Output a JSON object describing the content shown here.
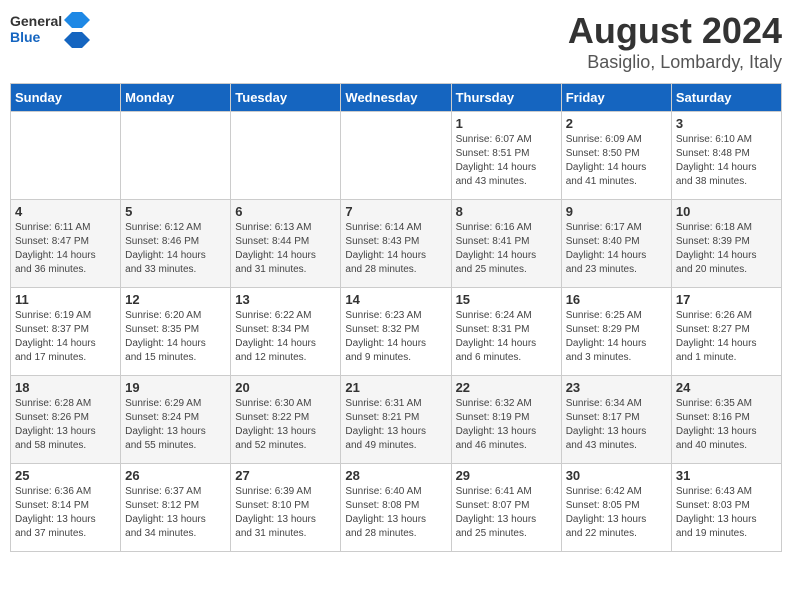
{
  "header": {
    "logo_general": "General",
    "logo_blue": "Blue",
    "title": "August 2024",
    "subtitle": "Basiglio, Lombardy, Italy"
  },
  "days_of_week": [
    "Sunday",
    "Monday",
    "Tuesday",
    "Wednesday",
    "Thursday",
    "Friday",
    "Saturday"
  ],
  "weeks": [
    [
      {
        "day": "",
        "info": ""
      },
      {
        "day": "",
        "info": ""
      },
      {
        "day": "",
        "info": ""
      },
      {
        "day": "",
        "info": ""
      },
      {
        "day": "1",
        "info": "Sunrise: 6:07 AM\nSunset: 8:51 PM\nDaylight: 14 hours\nand 43 minutes."
      },
      {
        "day": "2",
        "info": "Sunrise: 6:09 AM\nSunset: 8:50 PM\nDaylight: 14 hours\nand 41 minutes."
      },
      {
        "day": "3",
        "info": "Sunrise: 6:10 AM\nSunset: 8:48 PM\nDaylight: 14 hours\nand 38 minutes."
      }
    ],
    [
      {
        "day": "4",
        "info": "Sunrise: 6:11 AM\nSunset: 8:47 PM\nDaylight: 14 hours\nand 36 minutes."
      },
      {
        "day": "5",
        "info": "Sunrise: 6:12 AM\nSunset: 8:46 PM\nDaylight: 14 hours\nand 33 minutes."
      },
      {
        "day": "6",
        "info": "Sunrise: 6:13 AM\nSunset: 8:44 PM\nDaylight: 14 hours\nand 31 minutes."
      },
      {
        "day": "7",
        "info": "Sunrise: 6:14 AM\nSunset: 8:43 PM\nDaylight: 14 hours\nand 28 minutes."
      },
      {
        "day": "8",
        "info": "Sunrise: 6:16 AM\nSunset: 8:41 PM\nDaylight: 14 hours\nand 25 minutes."
      },
      {
        "day": "9",
        "info": "Sunrise: 6:17 AM\nSunset: 8:40 PM\nDaylight: 14 hours\nand 23 minutes."
      },
      {
        "day": "10",
        "info": "Sunrise: 6:18 AM\nSunset: 8:39 PM\nDaylight: 14 hours\nand 20 minutes."
      }
    ],
    [
      {
        "day": "11",
        "info": "Sunrise: 6:19 AM\nSunset: 8:37 PM\nDaylight: 14 hours\nand 17 minutes."
      },
      {
        "day": "12",
        "info": "Sunrise: 6:20 AM\nSunset: 8:35 PM\nDaylight: 14 hours\nand 15 minutes."
      },
      {
        "day": "13",
        "info": "Sunrise: 6:22 AM\nSunset: 8:34 PM\nDaylight: 14 hours\nand 12 minutes."
      },
      {
        "day": "14",
        "info": "Sunrise: 6:23 AM\nSunset: 8:32 PM\nDaylight: 14 hours\nand 9 minutes."
      },
      {
        "day": "15",
        "info": "Sunrise: 6:24 AM\nSunset: 8:31 PM\nDaylight: 14 hours\nand 6 minutes."
      },
      {
        "day": "16",
        "info": "Sunrise: 6:25 AM\nSunset: 8:29 PM\nDaylight: 14 hours\nand 3 minutes."
      },
      {
        "day": "17",
        "info": "Sunrise: 6:26 AM\nSunset: 8:27 PM\nDaylight: 14 hours\nand 1 minute."
      }
    ],
    [
      {
        "day": "18",
        "info": "Sunrise: 6:28 AM\nSunset: 8:26 PM\nDaylight: 13 hours\nand 58 minutes."
      },
      {
        "day": "19",
        "info": "Sunrise: 6:29 AM\nSunset: 8:24 PM\nDaylight: 13 hours\nand 55 minutes."
      },
      {
        "day": "20",
        "info": "Sunrise: 6:30 AM\nSunset: 8:22 PM\nDaylight: 13 hours\nand 52 minutes."
      },
      {
        "day": "21",
        "info": "Sunrise: 6:31 AM\nSunset: 8:21 PM\nDaylight: 13 hours\nand 49 minutes."
      },
      {
        "day": "22",
        "info": "Sunrise: 6:32 AM\nSunset: 8:19 PM\nDaylight: 13 hours\nand 46 minutes."
      },
      {
        "day": "23",
        "info": "Sunrise: 6:34 AM\nSunset: 8:17 PM\nDaylight: 13 hours\nand 43 minutes."
      },
      {
        "day": "24",
        "info": "Sunrise: 6:35 AM\nSunset: 8:16 PM\nDaylight: 13 hours\nand 40 minutes."
      }
    ],
    [
      {
        "day": "25",
        "info": "Sunrise: 6:36 AM\nSunset: 8:14 PM\nDaylight: 13 hours\nand 37 minutes."
      },
      {
        "day": "26",
        "info": "Sunrise: 6:37 AM\nSunset: 8:12 PM\nDaylight: 13 hours\nand 34 minutes."
      },
      {
        "day": "27",
        "info": "Sunrise: 6:39 AM\nSunset: 8:10 PM\nDaylight: 13 hours\nand 31 minutes."
      },
      {
        "day": "28",
        "info": "Sunrise: 6:40 AM\nSunset: 8:08 PM\nDaylight: 13 hours\nand 28 minutes."
      },
      {
        "day": "29",
        "info": "Sunrise: 6:41 AM\nSunset: 8:07 PM\nDaylight: 13 hours\nand 25 minutes."
      },
      {
        "day": "30",
        "info": "Sunrise: 6:42 AM\nSunset: 8:05 PM\nDaylight: 13 hours\nand 22 minutes."
      },
      {
        "day": "31",
        "info": "Sunrise: 6:43 AM\nSunset: 8:03 PM\nDaylight: 13 hours\nand 19 minutes."
      }
    ]
  ]
}
